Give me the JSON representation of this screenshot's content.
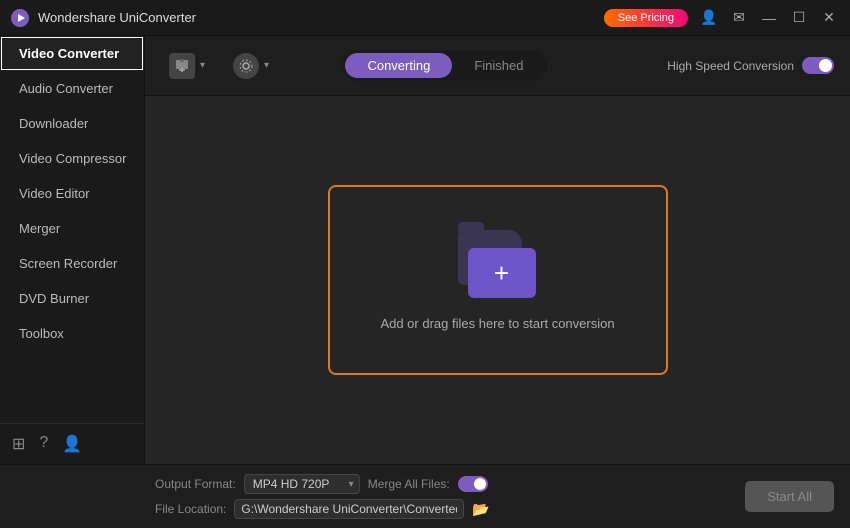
{
  "app": {
    "title": "Wondershare UniConverter",
    "logo_char": "🎬"
  },
  "titlebar": {
    "pricing_btn": "See Pricing",
    "window_controls": [
      "—",
      "☐",
      "✕"
    ]
  },
  "sidebar": {
    "items": [
      {
        "id": "video-converter",
        "label": "Video Converter",
        "active": true
      },
      {
        "id": "audio-converter",
        "label": "Audio Converter"
      },
      {
        "id": "downloader",
        "label": "Downloader"
      },
      {
        "id": "video-compressor",
        "label": "Video Compressor"
      },
      {
        "id": "video-editor",
        "label": "Video Editor"
      },
      {
        "id": "merger",
        "label": "Merger"
      },
      {
        "id": "screen-recorder",
        "label": "Screen Recorder"
      },
      {
        "id": "dvd-burner",
        "label": "DVD Burner"
      },
      {
        "id": "toolbox",
        "label": "Toolbox"
      }
    ],
    "bottom_icons": [
      "⊞",
      "?",
      "👤"
    ]
  },
  "toolbar": {
    "add_btn_label": "",
    "settings_btn_label": "",
    "tabs": [
      {
        "id": "converting",
        "label": "Converting",
        "active": true
      },
      {
        "id": "finished",
        "label": "Finished",
        "active": false
      }
    ],
    "high_speed_label": "High Speed Conversion"
  },
  "dropzone": {
    "text": "Add or drag files here to start conversion"
  },
  "bottombar": {
    "output_format_label": "Output Format:",
    "output_format_value": "MP4 HD 720P",
    "merge_label": "Merge All Files:",
    "file_location_label": "File Location:",
    "file_location_value": "G:\\Wondershare UniConverter\\Converted",
    "start_all_btn": "Start All"
  },
  "colors": {
    "accent": "#7c5cbf",
    "orange": "#e07820",
    "folder_back": "#3a3550",
    "folder_front": "#6c55c9"
  }
}
